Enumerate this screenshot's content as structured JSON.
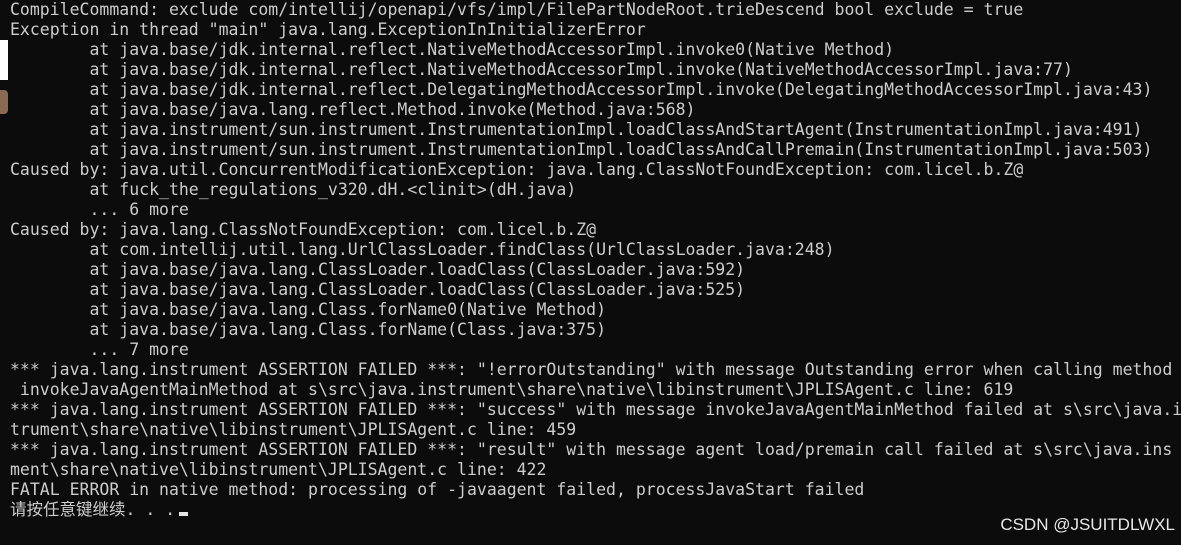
{
  "terminal": {
    "lines": [
      "CompileCommand: exclude com/intellij/openapi/vfs/impl/FilePartNodeRoot.trieDescend bool exclude = true",
      "Exception in thread \"main\" java.lang.ExceptionInInitializerError",
      "        at java.base/jdk.internal.reflect.NativeMethodAccessorImpl.invoke0(Native Method)",
      "        at java.base/jdk.internal.reflect.NativeMethodAccessorImpl.invoke(NativeMethodAccessorImpl.java:77)",
      "        at java.base/jdk.internal.reflect.DelegatingMethodAccessorImpl.invoke(DelegatingMethodAccessorImpl.java:43)",
      "        at java.base/java.lang.reflect.Method.invoke(Method.java:568)",
      "        at java.instrument/sun.instrument.InstrumentationImpl.loadClassAndStartAgent(InstrumentationImpl.java:491)",
      "        at java.instrument/sun.instrument.InstrumentationImpl.loadClassAndCallPremain(InstrumentationImpl.java:503)",
      "Caused by: java.util.ConcurrentModificationException: java.lang.ClassNotFoundException: com.licel.b.Z@",
      "        at fuck_the_regulations_v320.dH.<clinit>(dH.java)",
      "        ... 6 more",
      "Caused by: java.lang.ClassNotFoundException: com.licel.b.Z@",
      "        at com.intellij.util.lang.UrlClassLoader.findClass(UrlClassLoader.java:248)",
      "        at java.base/java.lang.ClassLoader.loadClass(ClassLoader.java:592)",
      "        at java.base/java.lang.ClassLoader.loadClass(ClassLoader.java:525)",
      "        at java.base/java.lang.Class.forName0(Native Method)",
      "        at java.base/java.lang.Class.forName(Class.java:375)",
      "        ... 7 more",
      "*** java.lang.instrument ASSERTION FAILED ***: \"!errorOutstanding\" with message Outstanding error when calling method",
      " invokeJavaAgentMainMethod at s\\src\\java.instrument\\share\\native\\libinstrument\\JPLISAgent.c line: 619",
      "*** java.lang.instrument ASSERTION FAILED ***: \"success\" with message invokeJavaAgentMainMethod failed at s\\src\\java.ins",
      "trument\\share\\native\\libinstrument\\JPLISAgent.c line: 459",
      "*** java.lang.instrument ASSERTION FAILED ***: \"result\" with message agent load/premain call failed at s\\src\\java.ins",
      "ment\\share\\native\\libinstrument\\JPLISAgent.c line: 422",
      "FATAL ERROR in native method: processing of -javaagent failed, processJavaStart failed"
    ],
    "prompt": "请按任意键继续. . ."
  },
  "watermark": "CSDN @JSUITDLWXL",
  "colors": {
    "background": "#0c0c0c",
    "text": "#cccccc",
    "cursor": "#e6e6e6"
  }
}
